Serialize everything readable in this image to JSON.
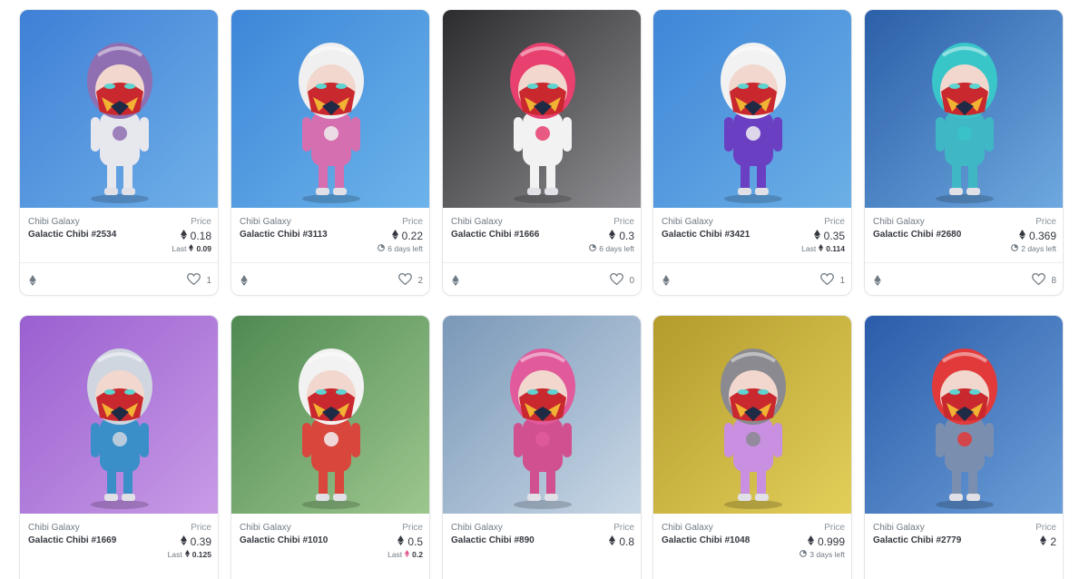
{
  "cards": [
    {
      "collection": "Chibi Galaxy",
      "name": "Galactic Chibi #2534",
      "price_label": "Price",
      "price": "0.18",
      "sub_type": "last",
      "sub_label": "Last",
      "sub_value": "0.09",
      "likes": "1",
      "bg_top": "#3f7fd6",
      "bg_bottom": "#6fb0e8",
      "accent": "#8f6fb1",
      "suit": "#e7e7ee"
    },
    {
      "collection": "Chibi Galaxy",
      "name": "Galactic Chibi #3113",
      "price_label": "Price",
      "price": "0.22",
      "sub_type": "time",
      "sub_value": "6 days left",
      "likes": "2",
      "bg_top": "#3d86d8",
      "bg_bottom": "#6cb4ea",
      "accent": "#f0f0f0",
      "suit": "#d66fb0"
    },
    {
      "collection": "Chibi Galaxy",
      "name": "Galactic Chibi #1666",
      "price_label": "Price",
      "price": "0.3",
      "sub_type": "time",
      "sub_value": "6 days left",
      "likes": "0",
      "bg_top": "#2c2c2e",
      "bg_bottom": "#8f8f93",
      "accent": "#e8406f",
      "suit": "#f2f2f2"
    },
    {
      "collection": "Chibi Galaxy",
      "name": "Galactic Chibi #3421",
      "price_label": "Price",
      "price": "0.35",
      "sub_type": "last",
      "sub_label": "Last",
      "sub_value": "0.114",
      "likes": "1",
      "bg_top": "#3f86d8",
      "bg_bottom": "#6cb0e6",
      "accent": "#f2f2f2",
      "suit": "#6b3fc2"
    },
    {
      "collection": "Chibi Galaxy",
      "name": "Galactic Chibi #2680",
      "price_label": "Price",
      "price": "0.369",
      "sub_type": "time",
      "sub_value": "2 days left",
      "likes": "8",
      "bg_top": "#2b5fa8",
      "bg_bottom": "#6fa9e0",
      "accent": "#38c6c9",
      "suit": "#3fb7c4"
    },
    {
      "collection": "Chibi Galaxy",
      "name": "Galactic Chibi #1669",
      "price_label": "Price",
      "price": "0.39",
      "sub_type": "last",
      "sub_label": "Last",
      "sub_value": "0.125",
      "likes": "",
      "bg_top": "#9a5fd0",
      "bg_bottom": "#c89be6",
      "accent": "#cfd6e0",
      "suit": "#3a8fc9"
    },
    {
      "collection": "Chibi Galaxy",
      "name": "Galactic Chibi #1010",
      "price_label": "Price",
      "price": "0.5",
      "sub_type": "last",
      "sub_label": "Last",
      "sub_value": "0.2",
      "likes": "",
      "bg_top": "#4f8a52",
      "bg_bottom": "#9dc78e",
      "accent": "#f2f2f2",
      "suit": "#d9463c"
    },
    {
      "collection": "Chibi Galaxy",
      "name": "Galactic Chibi #890",
      "price_label": "Price",
      "price": "0.8",
      "sub_type": "none",
      "sub_value": "",
      "likes": "",
      "bg_top": "#7a98b8",
      "bg_bottom": "#c9d8e6",
      "accent": "#e05a9c",
      "suit": "#d1508f"
    },
    {
      "collection": "Chibi Galaxy",
      "name": "Galactic Chibi #1048",
      "price_label": "Price",
      "price": "0.999",
      "sub_type": "time",
      "sub_value": "3 days left",
      "likes": "",
      "bg_top": "#b49b2c",
      "bg_bottom": "#e2cf5a",
      "accent": "#8a8a90",
      "suit": "#c98fe0"
    },
    {
      "collection": "Chibi Galaxy",
      "name": "Galactic Chibi #2779",
      "price_label": "Price",
      "price": "2",
      "sub_type": "none",
      "sub_value": "",
      "likes": "",
      "bg_top": "#2a5caa",
      "bg_bottom": "#6c9fd8",
      "accent": "#e23a3a",
      "suit": "#7a8fb0"
    }
  ],
  "icons": {
    "currency": "ethereum-icon",
    "favorite": "heart-icon",
    "timer": "clock-icon",
    "chain": "ethereum-chain-icon"
  }
}
